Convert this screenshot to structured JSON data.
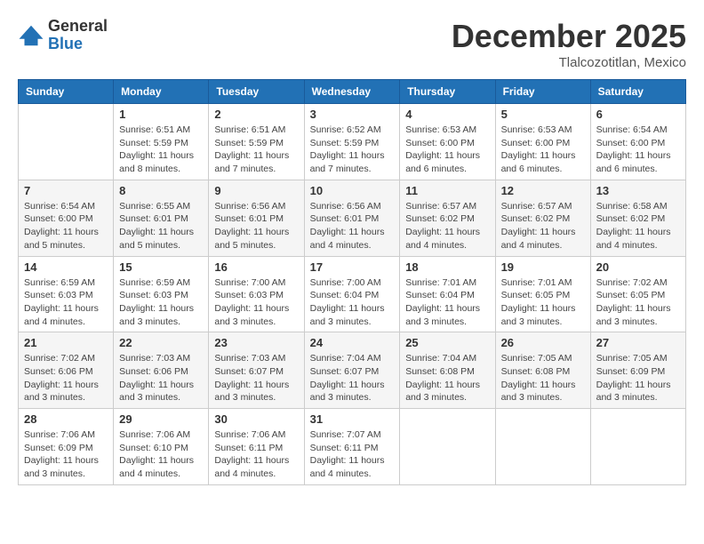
{
  "header": {
    "logo_general": "General",
    "logo_blue": "Blue",
    "month_title": "December 2025",
    "location": "Tlalcozotitlan, Mexico"
  },
  "days_of_week": [
    "Sunday",
    "Monday",
    "Tuesday",
    "Wednesday",
    "Thursday",
    "Friday",
    "Saturday"
  ],
  "weeks": [
    [
      {
        "day": "",
        "sunrise": "",
        "sunset": "",
        "daylight": ""
      },
      {
        "day": "1",
        "sunrise": "Sunrise: 6:51 AM",
        "sunset": "Sunset: 5:59 PM",
        "daylight": "Daylight: 11 hours and 8 minutes."
      },
      {
        "day": "2",
        "sunrise": "Sunrise: 6:51 AM",
        "sunset": "Sunset: 5:59 PM",
        "daylight": "Daylight: 11 hours and 7 minutes."
      },
      {
        "day": "3",
        "sunrise": "Sunrise: 6:52 AM",
        "sunset": "Sunset: 5:59 PM",
        "daylight": "Daylight: 11 hours and 7 minutes."
      },
      {
        "day": "4",
        "sunrise": "Sunrise: 6:53 AM",
        "sunset": "Sunset: 6:00 PM",
        "daylight": "Daylight: 11 hours and 6 minutes."
      },
      {
        "day": "5",
        "sunrise": "Sunrise: 6:53 AM",
        "sunset": "Sunset: 6:00 PM",
        "daylight": "Daylight: 11 hours and 6 minutes."
      },
      {
        "day": "6",
        "sunrise": "Sunrise: 6:54 AM",
        "sunset": "Sunset: 6:00 PM",
        "daylight": "Daylight: 11 hours and 6 minutes."
      }
    ],
    [
      {
        "day": "7",
        "sunrise": "Sunrise: 6:54 AM",
        "sunset": "Sunset: 6:00 PM",
        "daylight": "Daylight: 11 hours and 5 minutes."
      },
      {
        "day": "8",
        "sunrise": "Sunrise: 6:55 AM",
        "sunset": "Sunset: 6:01 PM",
        "daylight": "Daylight: 11 hours and 5 minutes."
      },
      {
        "day": "9",
        "sunrise": "Sunrise: 6:56 AM",
        "sunset": "Sunset: 6:01 PM",
        "daylight": "Daylight: 11 hours and 5 minutes."
      },
      {
        "day": "10",
        "sunrise": "Sunrise: 6:56 AM",
        "sunset": "Sunset: 6:01 PM",
        "daylight": "Daylight: 11 hours and 4 minutes."
      },
      {
        "day": "11",
        "sunrise": "Sunrise: 6:57 AM",
        "sunset": "Sunset: 6:02 PM",
        "daylight": "Daylight: 11 hours and 4 minutes."
      },
      {
        "day": "12",
        "sunrise": "Sunrise: 6:57 AM",
        "sunset": "Sunset: 6:02 PM",
        "daylight": "Daylight: 11 hours and 4 minutes."
      },
      {
        "day": "13",
        "sunrise": "Sunrise: 6:58 AM",
        "sunset": "Sunset: 6:02 PM",
        "daylight": "Daylight: 11 hours and 4 minutes."
      }
    ],
    [
      {
        "day": "14",
        "sunrise": "Sunrise: 6:59 AM",
        "sunset": "Sunset: 6:03 PM",
        "daylight": "Daylight: 11 hours and 4 minutes."
      },
      {
        "day": "15",
        "sunrise": "Sunrise: 6:59 AM",
        "sunset": "Sunset: 6:03 PM",
        "daylight": "Daylight: 11 hours and 3 minutes."
      },
      {
        "day": "16",
        "sunrise": "Sunrise: 7:00 AM",
        "sunset": "Sunset: 6:03 PM",
        "daylight": "Daylight: 11 hours and 3 minutes."
      },
      {
        "day": "17",
        "sunrise": "Sunrise: 7:00 AM",
        "sunset": "Sunset: 6:04 PM",
        "daylight": "Daylight: 11 hours and 3 minutes."
      },
      {
        "day": "18",
        "sunrise": "Sunrise: 7:01 AM",
        "sunset": "Sunset: 6:04 PM",
        "daylight": "Daylight: 11 hours and 3 minutes."
      },
      {
        "day": "19",
        "sunrise": "Sunrise: 7:01 AM",
        "sunset": "Sunset: 6:05 PM",
        "daylight": "Daylight: 11 hours and 3 minutes."
      },
      {
        "day": "20",
        "sunrise": "Sunrise: 7:02 AM",
        "sunset": "Sunset: 6:05 PM",
        "daylight": "Daylight: 11 hours and 3 minutes."
      }
    ],
    [
      {
        "day": "21",
        "sunrise": "Sunrise: 7:02 AM",
        "sunset": "Sunset: 6:06 PM",
        "daylight": "Daylight: 11 hours and 3 minutes."
      },
      {
        "day": "22",
        "sunrise": "Sunrise: 7:03 AM",
        "sunset": "Sunset: 6:06 PM",
        "daylight": "Daylight: 11 hours and 3 minutes."
      },
      {
        "day": "23",
        "sunrise": "Sunrise: 7:03 AM",
        "sunset": "Sunset: 6:07 PM",
        "daylight": "Daylight: 11 hours and 3 minutes."
      },
      {
        "day": "24",
        "sunrise": "Sunrise: 7:04 AM",
        "sunset": "Sunset: 6:07 PM",
        "daylight": "Daylight: 11 hours and 3 minutes."
      },
      {
        "day": "25",
        "sunrise": "Sunrise: 7:04 AM",
        "sunset": "Sunset: 6:08 PM",
        "daylight": "Daylight: 11 hours and 3 minutes."
      },
      {
        "day": "26",
        "sunrise": "Sunrise: 7:05 AM",
        "sunset": "Sunset: 6:08 PM",
        "daylight": "Daylight: 11 hours and 3 minutes."
      },
      {
        "day": "27",
        "sunrise": "Sunrise: 7:05 AM",
        "sunset": "Sunset: 6:09 PM",
        "daylight": "Daylight: 11 hours and 3 minutes."
      }
    ],
    [
      {
        "day": "28",
        "sunrise": "Sunrise: 7:06 AM",
        "sunset": "Sunset: 6:09 PM",
        "daylight": "Daylight: 11 hours and 3 minutes."
      },
      {
        "day": "29",
        "sunrise": "Sunrise: 7:06 AM",
        "sunset": "Sunset: 6:10 PM",
        "daylight": "Daylight: 11 hours and 4 minutes."
      },
      {
        "day": "30",
        "sunrise": "Sunrise: 7:06 AM",
        "sunset": "Sunset: 6:11 PM",
        "daylight": "Daylight: 11 hours and 4 minutes."
      },
      {
        "day": "31",
        "sunrise": "Sunrise: 7:07 AM",
        "sunset": "Sunset: 6:11 PM",
        "daylight": "Daylight: 11 hours and 4 minutes."
      },
      {
        "day": "",
        "sunrise": "",
        "sunset": "",
        "daylight": ""
      },
      {
        "day": "",
        "sunrise": "",
        "sunset": "",
        "daylight": ""
      },
      {
        "day": "",
        "sunrise": "",
        "sunset": "",
        "daylight": ""
      }
    ]
  ]
}
